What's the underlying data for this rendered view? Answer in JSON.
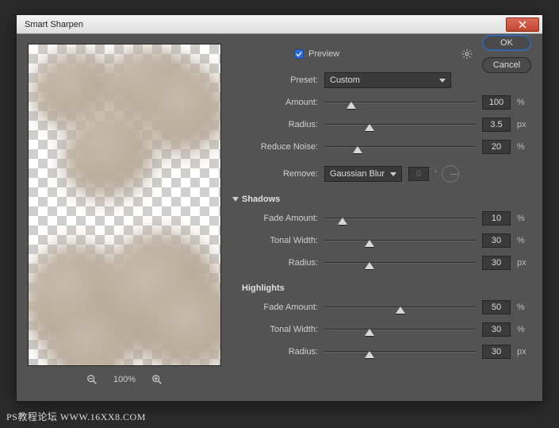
{
  "window": {
    "title": "Smart Sharpen"
  },
  "top": {
    "preview_label": "Preview",
    "preview_checked": true
  },
  "buttons": {
    "ok": "OK",
    "cancel": "Cancel"
  },
  "preset": {
    "label": "Preset:",
    "value": "Custom"
  },
  "main": {
    "amount": {
      "label": "Amount:",
      "value": "100",
      "unit": "%",
      "pct": 18
    },
    "radius": {
      "label": "Radius:",
      "value": "3.5",
      "unit": "px",
      "pct": 30
    },
    "noise": {
      "label": "Reduce Noise:",
      "value": "20",
      "unit": "%",
      "pct": 22
    },
    "remove": {
      "label": "Remove:",
      "value": "Gaussian Blur",
      "angle": "0",
      "deg": "°"
    }
  },
  "shadows": {
    "header": "Shadows",
    "fade": {
      "label": "Fade Amount:",
      "value": "10",
      "unit": "%",
      "pct": 12
    },
    "tonal": {
      "label": "Tonal Width:",
      "value": "30",
      "unit": "%",
      "pct": 30
    },
    "radius": {
      "label": "Radius:",
      "value": "30",
      "unit": "px",
      "pct": 30
    }
  },
  "highlights": {
    "header": "Highlights",
    "fade": {
      "label": "Fade Amount:",
      "value": "50",
      "unit": "%",
      "pct": 50
    },
    "tonal": {
      "label": "Tonal Width:",
      "value": "30",
      "unit": "%",
      "pct": 30
    },
    "radius": {
      "label": "Radius:",
      "value": "30",
      "unit": "px",
      "pct": 30
    }
  },
  "zoom": {
    "level": "100%"
  },
  "watermark": "PS教程论坛 WWW.16XX8.COM"
}
